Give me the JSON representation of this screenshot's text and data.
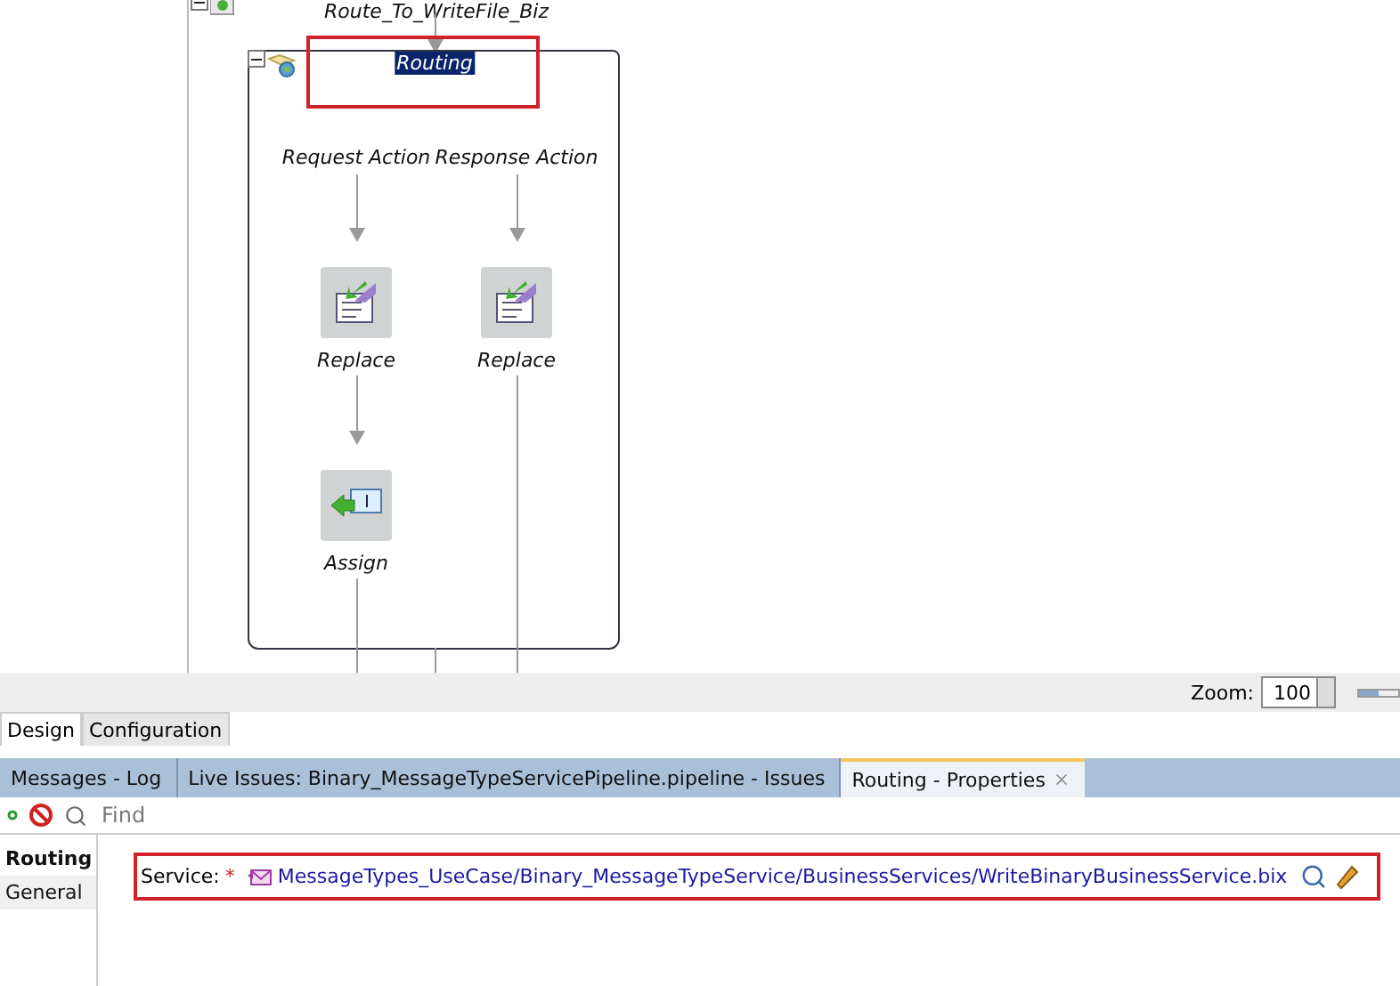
{
  "diagram": {
    "parent_node": {
      "label": "Route_To_WriteFile_Biz",
      "expanded": true
    },
    "routing": {
      "label": "Routing",
      "expanded": true,
      "selected": true,
      "highlighted": true
    },
    "branches": [
      {
        "label": "Request Action",
        "nodes": [
          {
            "kind": "replace",
            "label": "Replace"
          },
          {
            "kind": "assign",
            "label": "Assign"
          }
        ]
      },
      {
        "label": "Response Action",
        "nodes": [
          {
            "kind": "replace",
            "label": "Replace"
          }
        ]
      }
    ]
  },
  "zoom": {
    "label": "Zoom:",
    "value": "100",
    "level": 0.5
  },
  "editor_tabs": [
    {
      "label": "Design",
      "selected": true
    },
    {
      "label": "Configuration",
      "selected": false
    }
  ],
  "panel_tabs": [
    {
      "label": "Messages - Log",
      "selected": false,
      "closable": false
    },
    {
      "label": "Live Issues: Binary_MessageTypeServicePipeline.pipeline - Issues",
      "selected": false,
      "closable": false
    },
    {
      "label": "Routing - Properties",
      "selected": true,
      "closable": true
    }
  ],
  "search": {
    "placeholder": "Find"
  },
  "side_tabs": [
    {
      "label": "Routing",
      "selected": true
    },
    {
      "label": "General",
      "selected": false
    }
  ],
  "service": {
    "label": "Service:",
    "required_mark": "*",
    "value": "MessageTypes_UseCase/Binary_MessageTypeService/BusinessServices/WriteBinaryBusinessService.bix",
    "highlighted": true
  }
}
